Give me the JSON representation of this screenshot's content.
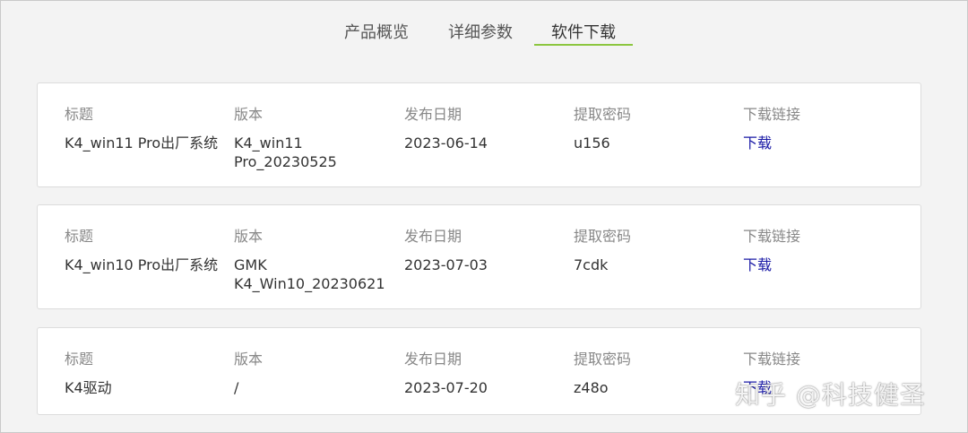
{
  "tabs": [
    {
      "label": "产品概览"
    },
    {
      "label": "详细参数"
    },
    {
      "label": "软件下载"
    }
  ],
  "active_tab": "软件下载",
  "accent_color": "#8cc63f",
  "link_color": "#1a1aa6",
  "columns": {
    "title": "标题",
    "version": "版本",
    "date": "发布日期",
    "code": "提取密码",
    "link": "下载链接"
  },
  "downloads": [
    {
      "title": "K4_win11 Pro出厂系统",
      "version_line1": "K4_win11",
      "version_line2": "Pro_20230525",
      "date": "2023-06-14",
      "code": "u156",
      "link": "下载"
    },
    {
      "title": "K4_win10 Pro出厂系统",
      "version_line1": "GMK",
      "version_line2": "K4_Win10_20230621",
      "date": "2023-07-03",
      "code": "7cdk",
      "link": "下载"
    },
    {
      "title": "K4驱动",
      "version_line1": "/",
      "version_line2": "",
      "date": "2023-07-20",
      "code": "z48o",
      "link": "下载"
    }
  ],
  "watermark": "知乎 @科技健圣"
}
